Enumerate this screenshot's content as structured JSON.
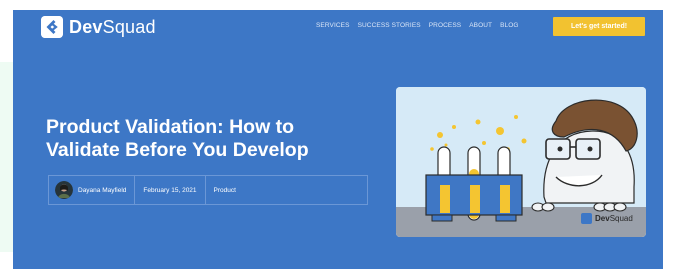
{
  "header": {
    "logo_bold": "Dev",
    "logo_rest": "Squad",
    "nav": [
      "SERVICES",
      "SUCCESS STORIES",
      "PROCESS",
      "ABOUT",
      "BLOG"
    ],
    "cta_label": "Let's get started!"
  },
  "article": {
    "title_line1": "Product Validation: How to",
    "title_line2": "Validate Before You Develop",
    "author": "Dayana Mayfield",
    "date": "February 15, 2021",
    "category": "Product"
  },
  "illustration": {
    "brand_bold": "Dev",
    "brand_rest": "Squad"
  },
  "colors": {
    "hero_background": "#3d77c6",
    "cta_background": "#f2c230",
    "page_background": "#ffffff",
    "mint_strip": "#eefbf3"
  },
  "icons": [
    "devsquad-logo-icon",
    "author-avatar",
    "scientist-lab-illustration"
  ]
}
